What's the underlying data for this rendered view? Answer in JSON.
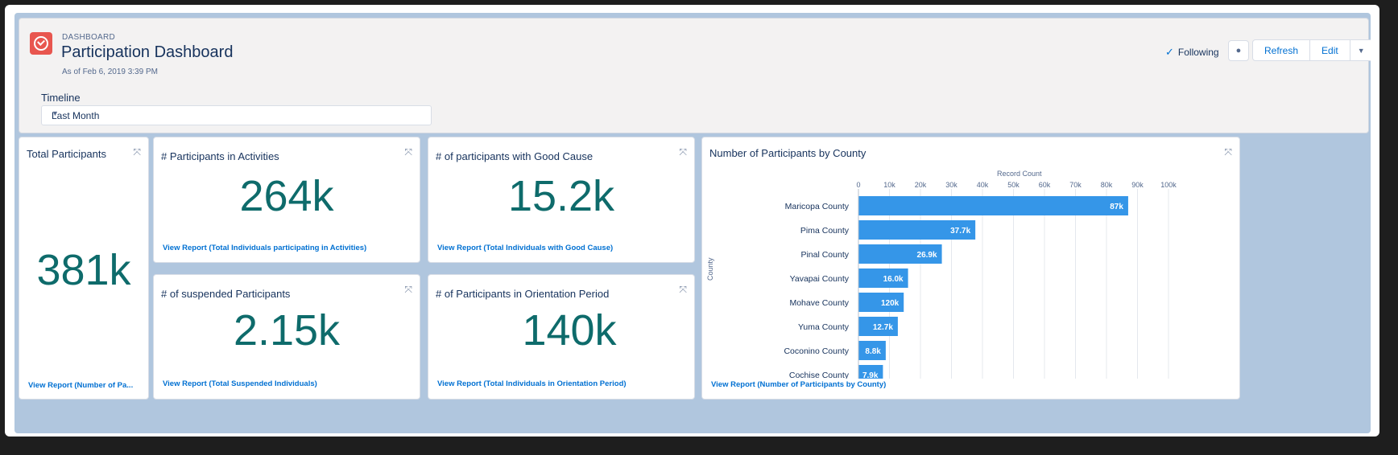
{
  "header": {
    "eyebrow": "DASHBOARD",
    "title": "Participation Dashboard",
    "as_of": "As of Feb 6, 2019 3:39 PM",
    "following_label": "Following",
    "refresh_label": "Refresh",
    "edit_label": "Edit"
  },
  "filter": {
    "label": "Timeline",
    "value": "Last Month"
  },
  "cards": {
    "total": {
      "title": "Total Participants",
      "value": "381k",
      "link": "View Report (Number of Pa..."
    },
    "activities": {
      "title": "# Participants in Activities",
      "value": "264k",
      "link": "View Report (Total Individuals participating in Activities)"
    },
    "good_cause": {
      "title": "# of participants with Good Cause",
      "value": "15.2k",
      "link": "View Report (Total Individuals with Good Cause)"
    },
    "suspended": {
      "title": "# of suspended Participants",
      "value": "2.15k",
      "link": "View Report (Total Suspended Individuals)"
    },
    "orientation": {
      "title": "# of Participants in Orientation Period",
      "value": "140k",
      "link": "View Report (Total Individuals in Orientation Period)"
    },
    "county": {
      "title": "Number of Participants by County",
      "link": "View Report (Number of Participants by County)"
    }
  },
  "chart_data": {
    "type": "bar",
    "orientation": "horizontal",
    "title": "Number of Participants by County",
    "xlabel": "Record Count",
    "ylabel": "County",
    "xlim": [
      0,
      100000
    ],
    "xticks": [
      "0",
      "10k",
      "20k",
      "30k",
      "40k",
      "50k",
      "60k",
      "70k",
      "80k",
      "90k",
      "100k"
    ],
    "categories": [
      "Maricopa County",
      "Pima County",
      "Pinal County",
      "Yavapai County",
      "Mohave County",
      "Yuma County",
      "Coconino County",
      "Cochise County"
    ],
    "values": [
      87000,
      37700,
      26900,
      16000,
      14600,
      12700,
      8800,
      7900
    ],
    "labels": [
      "87k",
      "37.7k",
      "26.9k",
      "16.0k",
      "120k",
      "12.7k",
      "8.8k",
      "7.9k"
    ],
    "bar_color": "#3596e8",
    "grid": true
  },
  "colors": {
    "metric": "#0e6b6b",
    "link": "#0070d2",
    "app_icon": "#e8564f"
  }
}
